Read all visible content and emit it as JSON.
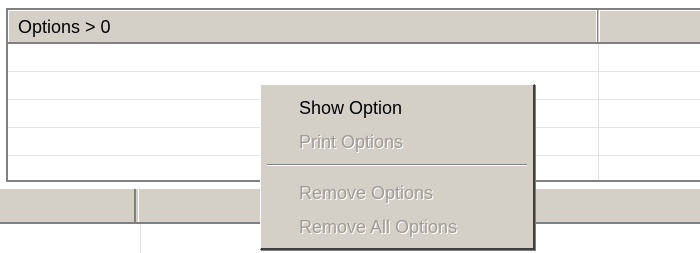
{
  "top_table": {
    "header": {
      "title": "Options > 0"
    }
  },
  "context_menu": {
    "items": [
      {
        "label": "Show Option",
        "enabled": true
      },
      {
        "label": "Print Options",
        "enabled": false
      },
      {
        "label": "Remove Options",
        "enabled": false
      },
      {
        "label": "Remove All Options",
        "enabled": false
      }
    ]
  },
  "colors": {
    "chrome": "#d4d0c8",
    "shadow": "#808080",
    "disabled_text": "#a09c94"
  }
}
